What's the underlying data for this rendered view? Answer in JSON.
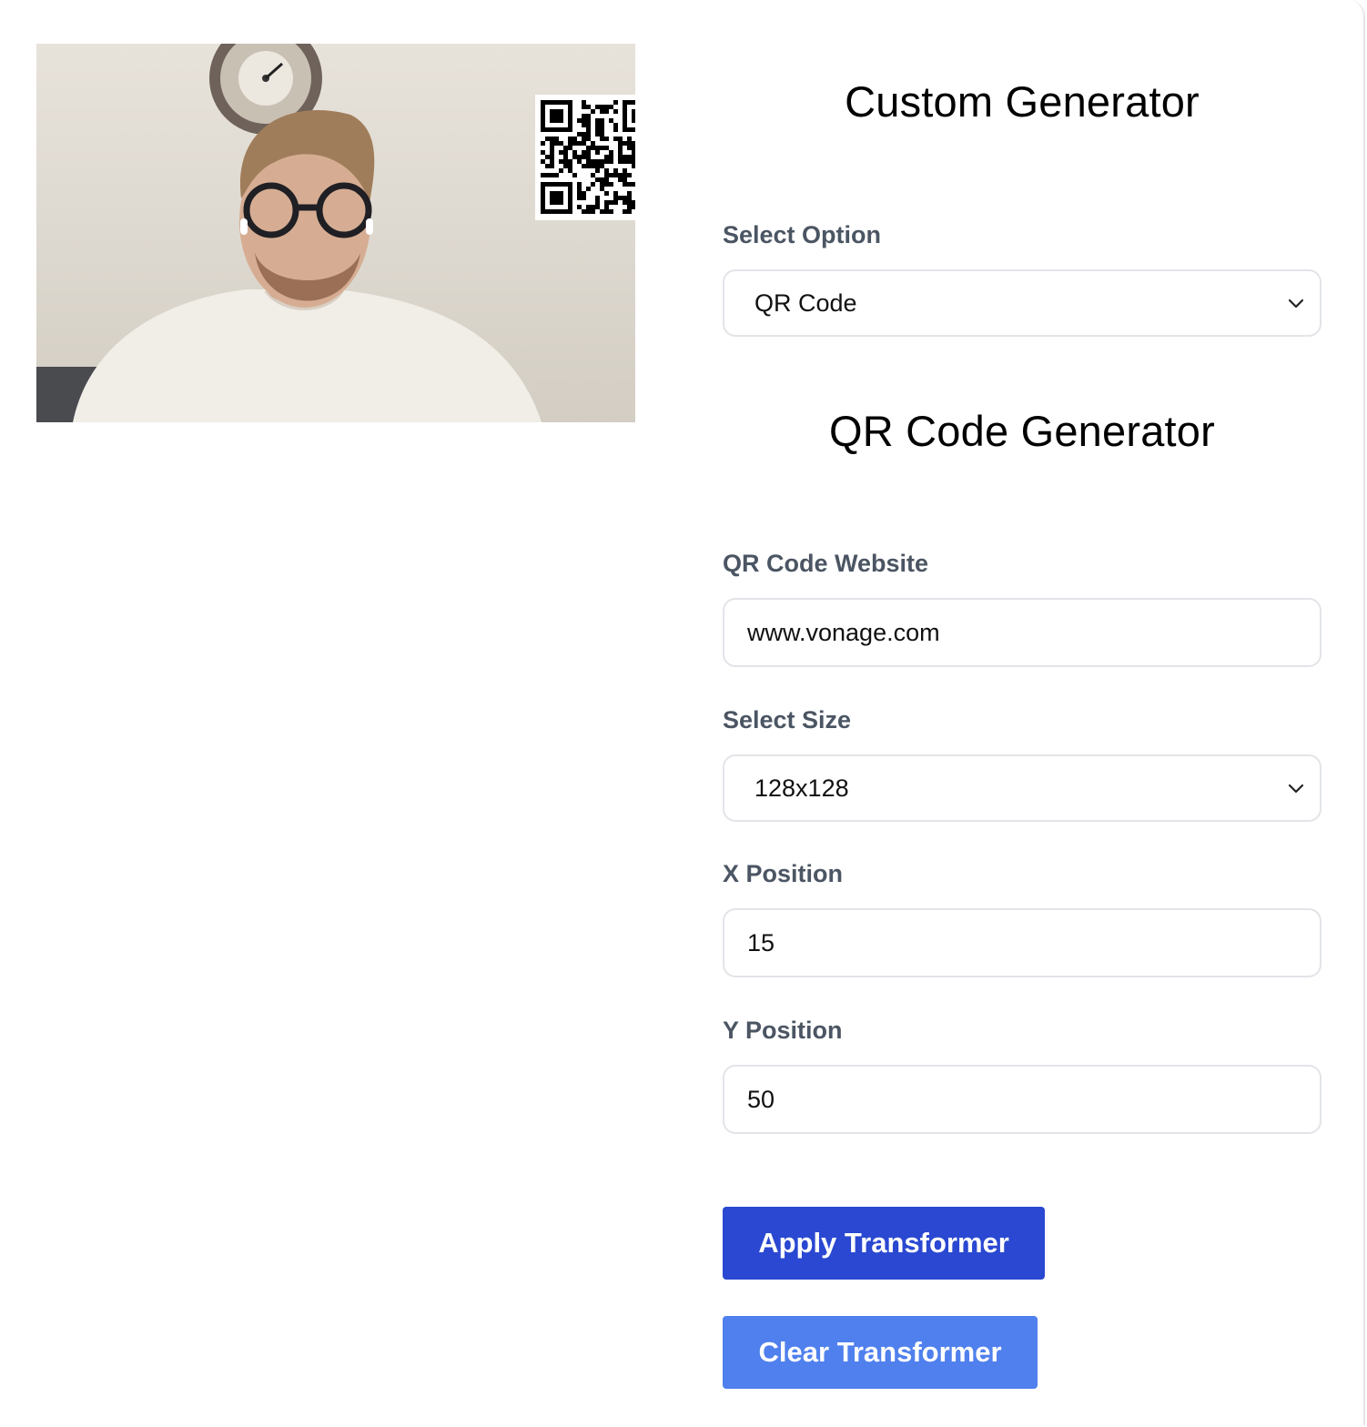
{
  "headings": {
    "custom": "Custom Generator",
    "qr": "QR Code Generator"
  },
  "form": {
    "option": {
      "label": "Select Option",
      "value": "QR Code"
    },
    "website": {
      "label": "QR Code Website",
      "value": "www.vonage.com"
    },
    "size": {
      "label": "Select Size",
      "value": "128x128"
    },
    "x_position": {
      "label": "X Position",
      "value": "15"
    },
    "y_position": {
      "label": "Y Position",
      "value": "50"
    }
  },
  "buttons": {
    "apply": "Apply Transformer",
    "clear": "Clear Transformer"
  },
  "colors": {
    "apply_button": "#2a48d1",
    "clear_button": "#4f80ed",
    "label_text": "#4b5563",
    "field_border": "#e2e4e8"
  },
  "icons": {
    "select_arrow": "chevron-down-icon"
  }
}
